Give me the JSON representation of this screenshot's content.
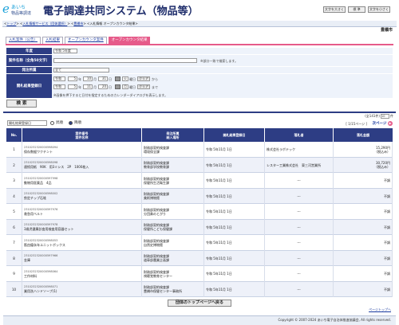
{
  "header": {
    "logo_mark": "e",
    "logo_line1": "あいち",
    "logo_line2": "物品等調達",
    "title": "電子調達共同システム（物品等）",
    "font_buttons": [
      "文字を大きく",
      "標 準",
      "文字を小さく"
    ],
    "city": "豊橋市"
  },
  "breadcrumb": {
    "items": [
      "トップ",
      "入札情報サービス（団体選択）",
      "豊橋市"
    ],
    "current": "入札情報 オープンカウンタ結果"
  },
  "tabs": [
    "入札案件（公告）",
    "入札結果",
    "オープンカウンタ案件",
    "オープンカウンタ結果"
  ],
  "form": {
    "year_label": "年度",
    "year_value": "令和 5年度",
    "case_label": "案件名称（全角50文字）",
    "case_value": "",
    "case_note": "※部分一致で検索します。",
    "dept_label": "発注所属",
    "dept_value": "全て",
    "date_label": "開札結果登録日",
    "from": {
      "era": "令和",
      "year": "5",
      "month": "10",
      "day": "31"
    },
    "to": {
      "era": "令和",
      "year": "5",
      "month": "11",
      "day": "20"
    },
    "weekday_from": "火",
    "weekday_to": "月",
    "unit_year": "年",
    "unit_month": "月",
    "unit_day": "日",
    "weekday_suffix": "曜日",
    "clear_label": "クリア",
    "from_suffix": "から",
    "to_suffix": "まで",
    "date_note": "※画像を押下すると日付を指定するためのカレンダーダイアログを表示します。",
    "search_button": "検 索"
  },
  "results": {
    "sort_value": "開札結果登録日",
    "sort_asc": "昇順",
    "sort_desc": "降順",
    "count_text": "(全141件)",
    "per_page": "10",
    "per_page_suffix": "件",
    "page_info": "[ 1/15ページ ]",
    "next_page": "次ページ",
    "columns": [
      "No.",
      "案件番号\n案件名称",
      "発注所属\n納入場所",
      "開札結果登録日",
      "落札者",
      "落札金額"
    ],
    "rows": [
      {
        "no": "1",
        "id": "2310232320000598094",
        "name": "保存数据ワクチント",
        "dept": "財務部契約検査課",
        "place": "環境保全課",
        "date": "令和 5年11月 1日",
        "winner": "株式会社ラボテック",
        "amount": "15,290円",
        "amount_note": "（税込み）"
      },
      {
        "no": "2",
        "id": "2310232320000598098",
        "name": "連続用紙　90K　用3ミシス　2P　1000枚入",
        "dept": "財務部契約検査課",
        "place": "教育部学校教育課",
        "date": "令和 5年11月 1日",
        "winner": "レスター工業株式会社　東三河営業所",
        "amount": "30,720円",
        "amount_note": "（税込み）"
      },
      {
        "no": "3",
        "id": "2310232320000597998",
        "name": "動物用医薬品　4品",
        "dept": "財務部契約検査課",
        "place": "保健所生活衛生課",
        "date": "令和 5年11月 1日",
        "winner": "---",
        "amount": "不調",
        "amount_note": ""
      },
      {
        "no": "4",
        "id": "2310232320000598002",
        "name": "剪定チップ石堆",
        "dept": "財務部契約検査課",
        "place": "美術博物館",
        "date": "令和 5年11月 1日",
        "winner": "---",
        "amount": "不調",
        "amount_note": ""
      },
      {
        "no": "5",
        "id": "2310232320000597976",
        "name": "救急用ベルト",
        "dept": "財務部契約検査課",
        "place": "分団奏のとがり",
        "date": "令和 5年11月 1日",
        "winner": "---",
        "amount": "不調",
        "amount_note": ""
      },
      {
        "no": "6",
        "id": "2310232320000597978",
        "name": "3歳児健康診査用検査用容器セット",
        "dept": "財務部契約検査課",
        "place": "保健所こども保健課",
        "date": "令和 5年11月 1日",
        "winner": "---",
        "amount": "不調",
        "amount_note": ""
      },
      {
        "no": "7",
        "id": "2310232320000598053",
        "name": "筋由優永年ユニットボックス",
        "dept": "財務部契約検査課",
        "place": "自然史博物館",
        "date": "令和 5年11月 1日",
        "winner": "---",
        "amount": "不調",
        "amount_note": ""
      },
      {
        "no": "8",
        "id": "2310232320000597966",
        "name": "金庫",
        "dept": "財務部契約検査課",
        "place": "道車部農業企画課",
        "date": "令和 5年11月 1日",
        "winner": "---",
        "amount": "不調",
        "amount_note": ""
      },
      {
        "no": "9",
        "id": "2310232320000598064",
        "name": "工作材料",
        "dept": "財務部契約検査課",
        "place": "視聴覚教育センター",
        "date": "令和 5年11月 1日",
        "winner": "---",
        "amount": "不調",
        "amount_note": ""
      },
      {
        "no": "10",
        "id": "2310232320000598071",
        "name": "業用洗ハンドソープ(1)",
        "dept": "財務部契約検査課",
        "place": "豊橋市保健センター事務所",
        "date": "令和 5年11月 1日",
        "winner": "---",
        "amount": "不調",
        "amount_note": ""
      }
    ]
  },
  "top_button": "団体のトップページへ戻る",
  "page_top": "ページトップへ",
  "footer": "Copyright © 2007-2024 あいち電子自治体推進協議会, All rights reserved."
}
